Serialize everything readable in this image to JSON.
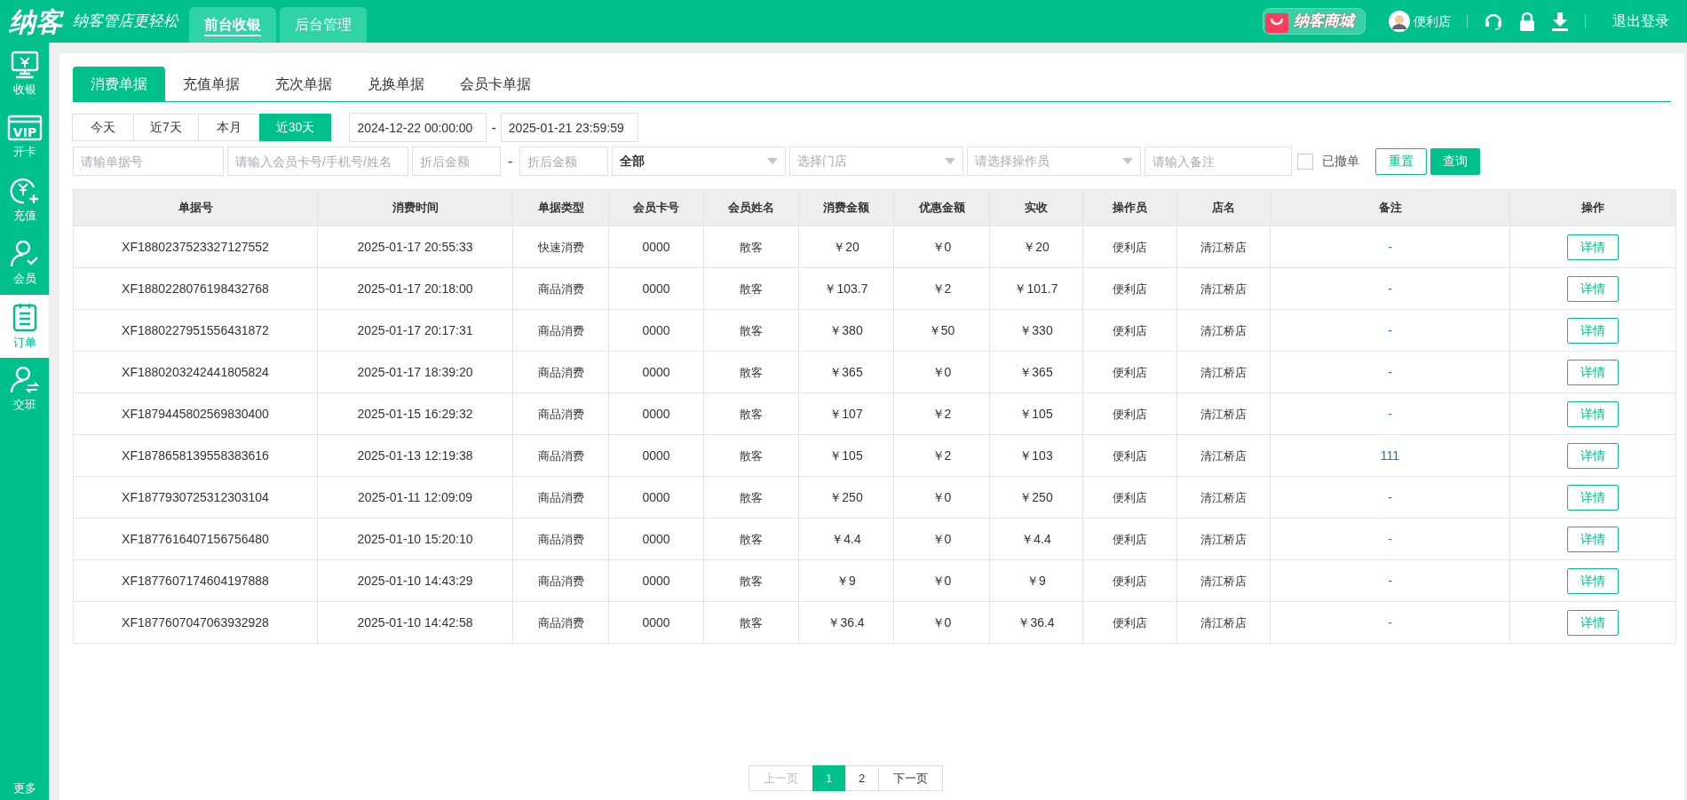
{
  "header": {
    "logo": "纳客",
    "slogan": "纳客管店更轻松",
    "nav": [
      {
        "label": "前台收银",
        "selected": true
      },
      {
        "label": "后台管理",
        "selected": false
      }
    ],
    "mall": "纳客商城",
    "user": "便利店",
    "logout": "退出登录"
  },
  "sidebar": {
    "items": [
      {
        "label": "收银",
        "selected": false
      },
      {
        "label": "开卡",
        "icon_text": "VIP",
        "selected": false
      },
      {
        "label": "充值",
        "selected": false
      },
      {
        "label": "会员",
        "selected": false
      },
      {
        "label": "订单",
        "selected": true
      },
      {
        "label": "交班",
        "selected": false
      }
    ],
    "more": "更多"
  },
  "tabs": [
    {
      "label": "消费单据",
      "selected": true
    },
    {
      "label": "充值单据",
      "selected": false
    },
    {
      "label": "充次单据",
      "selected": false
    },
    {
      "label": "兑换单据",
      "selected": false
    },
    {
      "label": "会员卡单据",
      "selected": false
    }
  ],
  "filters": {
    "ranges": [
      {
        "label": "今天",
        "selected": false
      },
      {
        "label": "近7天",
        "selected": false
      },
      {
        "label": "本月",
        "selected": false
      },
      {
        "label": "近30天",
        "selected": true
      }
    ],
    "date_from": "2024-12-22 00:00:00",
    "date_sep": "-",
    "date_to": "2025-01-21 23:59:59",
    "order_no": {
      "placeholder": "请输单据号"
    },
    "member": {
      "placeholder": "请输入会员卡号/手机号/姓名"
    },
    "amount_min": {
      "placeholder": "折后金额"
    },
    "amount_sep": "-",
    "amount_max": {
      "placeholder": "折后金额"
    },
    "type_select": {
      "value": "全部"
    },
    "store_select": {
      "placeholder": "选择门店"
    },
    "operator_select": {
      "placeholder": "请选择操作员"
    },
    "remark": {
      "placeholder": "请输入备注"
    },
    "revoked": {
      "label": "已撤单",
      "checked": false
    },
    "reset": "重置",
    "search": "查询"
  },
  "table": {
    "columns": [
      "单据号",
      "消费时间",
      "单据类型",
      "会员卡号",
      "会员姓名",
      "消费金额",
      "优惠金额",
      "实收",
      "操作员",
      "店名",
      "备注",
      "操作"
    ],
    "rows": [
      [
        "XF1880237523327127552",
        "2025-01-17 20:55:33",
        "快速消费",
        "0000",
        "散客",
        "￥20",
        "￥0",
        "￥20",
        "便利店",
        "清江桥店",
        "-",
        "详情"
      ],
      [
        "XF1880228076198432768",
        "2025-01-17 20:18:00",
        "商品消费",
        "0000",
        "散客",
        "￥103.7",
        "￥2",
        "￥101.7",
        "便利店",
        "清江桥店",
        "-",
        "详情"
      ],
      [
        "XF1880227951556431872",
        "2025-01-17 20:17:31",
        "商品消费",
        "0000",
        "散客",
        "￥380",
        "￥50",
        "￥330",
        "便利店",
        "清江桥店",
        "-",
        "详情"
      ],
      [
        "XF1880203242441805824",
        "2025-01-17 18:39:20",
        "商品消费",
        "0000",
        "散客",
        "￥365",
        "￥0",
        "￥365",
        "便利店",
        "清江桥店",
        "-",
        "详情"
      ],
      [
        "XF1879445802569830400",
        "2025-01-15 16:29:32",
        "商品消费",
        "0000",
        "散客",
        "￥107",
        "￥2",
        "￥105",
        "便利店",
        "清江桥店",
        "-",
        "详情"
      ],
      [
        "XF1878658139558383616",
        "2025-01-13 12:19:38",
        "商品消费",
        "0000",
        "散客",
        "￥105",
        "￥2",
        "￥103",
        "便利店",
        "清江桥店",
        "111",
        "详情"
      ],
      [
        "XF1877930725312303104",
        "2025-01-11 12:09:09",
        "商品消费",
        "0000",
        "散客",
        "￥250",
        "￥0",
        "￥250",
        "便利店",
        "清江桥店",
        "-",
        "详情"
      ],
      [
        "XF1877616407156756480",
        "2025-01-10 15:20:10",
        "商品消费",
        "0000",
        "散客",
        "￥4.4",
        "￥0",
        "￥4.4",
        "便利店",
        "清江桥店",
        "-",
        "详情"
      ],
      [
        "XF1877607174604197888",
        "2025-01-10 14:43:29",
        "商品消费",
        "0000",
        "散客",
        "￥9",
        "￥0",
        "￥9",
        "便利店",
        "清江桥店",
        "-",
        "详情"
      ],
      [
        "XF1877607047063932928",
        "2025-01-10 14:42:58",
        "商品消费",
        "0000",
        "散客",
        "￥36.4",
        "￥0",
        "￥36.4",
        "便利店",
        "清江桥店",
        "-",
        "详情"
      ]
    ]
  },
  "pagination": {
    "prev": {
      "label": "上一页",
      "disabled": true
    },
    "pages": [
      {
        "label": "1",
        "selected": true
      },
      {
        "label": "2",
        "selected": false
      }
    ],
    "next": {
      "label": "下一页",
      "disabled": false
    }
  }
}
